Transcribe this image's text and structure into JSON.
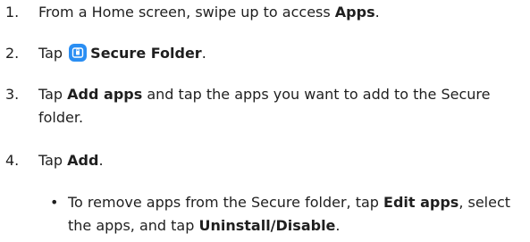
{
  "steps": [
    {
      "num": "1.",
      "pre": "From a Home screen, swipe up to access ",
      "bold": "Apps",
      "post": "."
    },
    {
      "num": "2.",
      "pre": "Tap ",
      "icon": "secure-folder-icon",
      "bold": "Secure Folder",
      "post": "."
    },
    {
      "num": "3.",
      "pre": "Tap ",
      "bold": "Add apps",
      "post": " and tap the apps you want to add to the Secure folder."
    },
    {
      "num": "4.",
      "pre": "Tap ",
      "bold": "Add",
      "post": "."
    }
  ],
  "sub_bullet": {
    "marker": "•",
    "pre": "To remove apps from the Secure folder, tap ",
    "bold1": "Edit apps",
    "mid": ", select the apps, and tap ",
    "bold2": "Uninstall/Disable",
    "post": "."
  },
  "colors": {
    "text": "#1f1f1f",
    "icon_bg": "#2a8ef3"
  }
}
